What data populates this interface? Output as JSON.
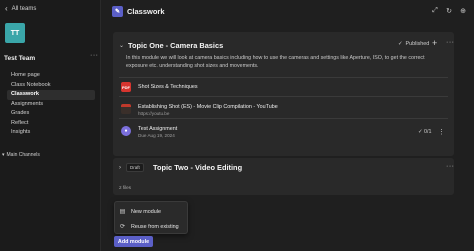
{
  "sidebar": {
    "back_label": "All teams",
    "avatar_initials": "TT",
    "team_name": "Test Team",
    "nav": [
      {
        "label": "Home page"
      },
      {
        "label": "Class Notebook"
      },
      {
        "label": "Classwork"
      },
      {
        "label": "Assignments"
      },
      {
        "label": "Grades"
      },
      {
        "label": "Reflect"
      },
      {
        "label": "Insights"
      }
    ],
    "active_index": 2,
    "main_channels_label": "Main Channels"
  },
  "header": {
    "title": "Classwork",
    "accent_color": "#5b5fc7"
  },
  "module1": {
    "title": "Topic One - Camera Basics",
    "status": "Published",
    "description": "In this module we will look at camera basics including how to use the cameras and settings like Aperture, ISO, to get the correct exposure etc. understanding shot sizes and movements.",
    "items": [
      {
        "title": "Shot Sizes & Techniques",
        "sub": "",
        "icon": "pdf-icon",
        "badge": "PDF"
      },
      {
        "title": "Establishing Shot (ES) - Movie Clip Compilation - YouTube",
        "sub": "https://youtu.be",
        "icon": "video-thumbnail"
      },
      {
        "title": "Test Assignment",
        "sub": "Due Aug 19, 2024",
        "icon": "assignment-icon",
        "status": "0/1"
      }
    ]
  },
  "module2": {
    "badge": "Draft",
    "title": "Topic Two - Video Editing",
    "files": "2 files"
  },
  "menu": {
    "items": [
      {
        "label": "New module",
        "icon": "module-icon"
      },
      {
        "label": "Reuse from existing",
        "icon": "reuse-icon"
      }
    ]
  },
  "add_button": {
    "label": "Add module"
  }
}
